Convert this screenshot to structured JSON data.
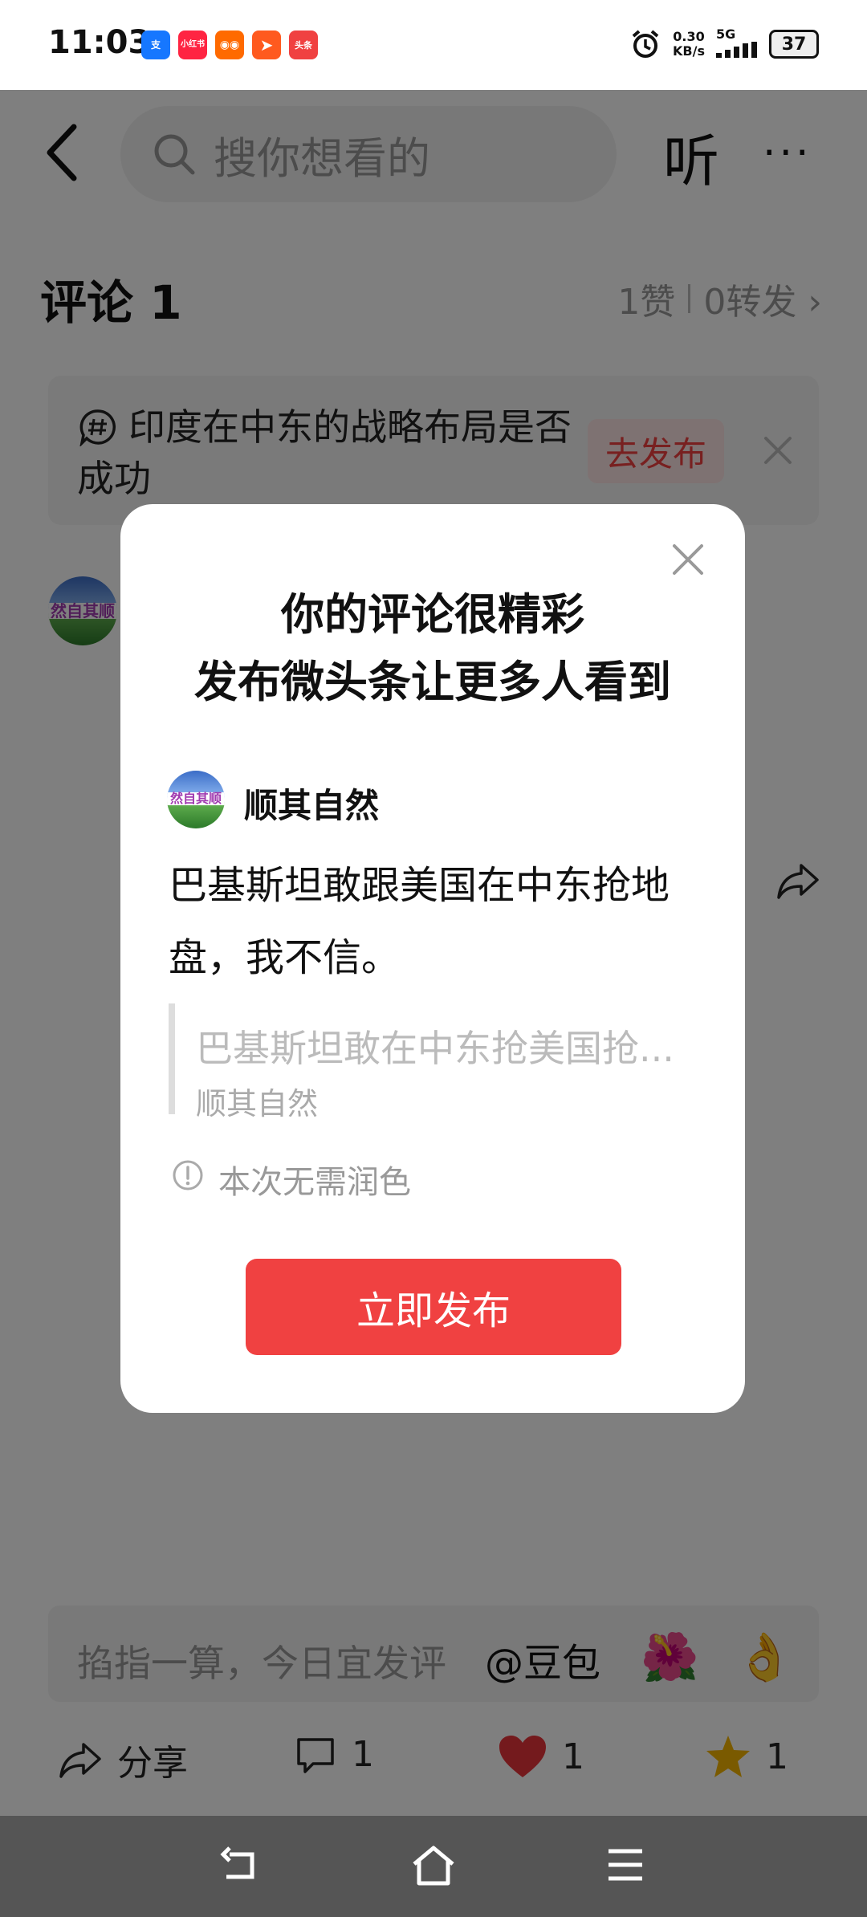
{
  "status_bar": {
    "time": "11:03",
    "apps": [
      {
        "name": "alipay-icon",
        "label": "支",
        "color": "#1677ff"
      },
      {
        "name": "xiaohongshu-icon",
        "label": "小红书",
        "color": "#ff2442"
      },
      {
        "name": "kuaishou-icon",
        "label": "◉◉",
        "color": "#ff6a00"
      },
      {
        "name": "send-app-icon",
        "label": "➤",
        "color": "#ff5a1f"
      },
      {
        "name": "toutiao-icon",
        "label": "头条",
        "color": "#f04141"
      }
    ],
    "net_speed": "0.30",
    "net_unit": "KB/s",
    "signal": "5G",
    "battery": "37"
  },
  "top_nav": {
    "search_placeholder": "搜你想看的",
    "listen_label": "听",
    "more_label": "···"
  },
  "comments": {
    "title": "评论 1",
    "likes": "1赞",
    "reposts": "0转发 ›"
  },
  "topic": {
    "text": "印度在中东的战略布局是否成功",
    "publish_label": "去发布"
  },
  "background_comment": {
    "avatar_text": "然自其顺",
    "trailing": "，"
  },
  "modal": {
    "title_line1": "你的评论很精彩",
    "title_line2": "发布微头条让更多人看到",
    "user": "顺其自然",
    "avatar_text": "然自其顺",
    "body": "巴基斯坦敢跟美国在中东抢地盘，我不信。",
    "quote": "巴基斯坦敢在中东抢美国抢...",
    "quote_user": "顺其自然",
    "note": "本次无需润色",
    "button": "立即发布"
  },
  "comment_bar": {
    "placeholder": "掐指一算，今日宜发评",
    "mention": "@豆包",
    "emoji1": "🌺",
    "emoji2": "👌"
  },
  "actions": {
    "share": "分享",
    "comments": "1",
    "likes": "1",
    "favorites": "1"
  },
  "colors": {
    "accent": "#f04141",
    "like": "#e8343a",
    "star": "#f5b400"
  }
}
